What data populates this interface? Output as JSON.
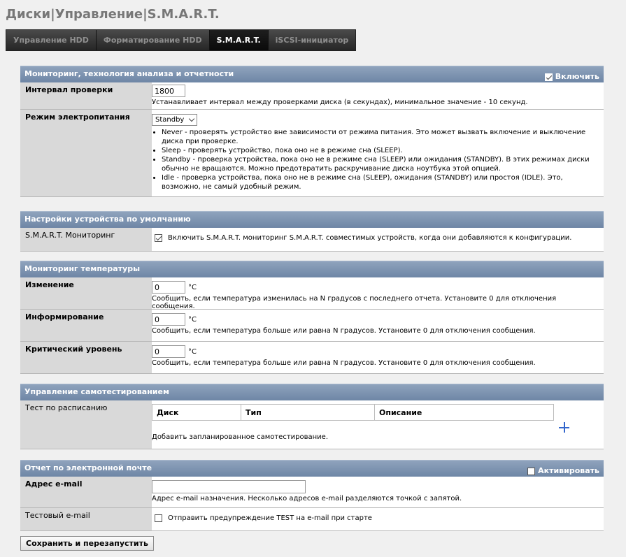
{
  "page_title": "Диски|Управление|S.M.A.R.T.",
  "tabs": [
    {
      "label": "Управление HDD"
    },
    {
      "label": "Форматирование HDD"
    },
    {
      "label": "S.M.A.R.T."
    },
    {
      "label": "iSCSI-инициатор"
    }
  ],
  "active_tab": "S.M.A.R.T.",
  "monitoring": {
    "header": "Мониторинг, технология анализа и отчетности",
    "enable_label": "Включить",
    "enabled": true,
    "interval": {
      "label": "Интервал проверки",
      "value": "1800",
      "desc": "Устанавливает интервал между проверками диска (в секундах), минимальное значение - 10 секунд."
    },
    "power": {
      "label": "Режим электропитания",
      "selected": "Standby",
      "modes": [
        "Never - проверять устройство вне зависимости от режима питания. Это может вызвать включение и выключение диска при проверке.",
        "Sleep - проверять устройство, пока оно не в режиме сна (SLEEP).",
        "Standby - проверка устройства, пока оно не в режиме сна (SLEEP) или ожидания (STANDBY). В этих режимах диски обычно не вращаются. Можно предотвратить раскручивание диска ноутбука этой опцией.",
        "Idle - проверка устройства, пока оно не в режиме сна (SLEEP), ожидания (STANDBY) или простоя (IDLE). Это, возможно, не самый удобный режим."
      ]
    }
  },
  "defaults": {
    "header": "Настройки устройства по умолчанию",
    "smart_label": "S.M.A.R.T. Мониторинг",
    "smart_checked": true,
    "smart_text": "Включить S.M.A.R.T. мониторинг S.M.A.R.T. совместимых устройств, когда они добавляются к конфигурации."
  },
  "temperature": {
    "header": "Мониторинг температуры",
    "rows": [
      {
        "label": "Изменение",
        "value": "0",
        "unit": "°C",
        "desc": "Сообщить, если температура изменилась на N градусов с последнего отчета. Установите 0 для отключения сообщения."
      },
      {
        "label": "Информирование",
        "value": "0",
        "unit": "°C",
        "desc": "Сообщить, если температура больше или равна N градусов. Установите 0 для отключения сообщения."
      },
      {
        "label": "Критический уровень",
        "value": "0",
        "unit": "°C",
        "desc": "Сообщить, если температура больше или равна N градусов. Установите 0 для отключения сообщения."
      }
    ]
  },
  "selftest": {
    "header": "Управление самотестированием",
    "label": "Тест по расписанию",
    "columns": [
      "Диск",
      "Тип",
      "Описание"
    ],
    "add_text": "Добавить запланированное самотестирование."
  },
  "email": {
    "header": "Отчет по электронной почте",
    "activate_label": "Активировать",
    "activated": false,
    "address": {
      "label": "Адрес e-mail",
      "value": "",
      "desc": "Адрес e-mail назначения. Несколько адресов e-mail разделяются точкой с запятой."
    },
    "test": {
      "label": "Тестовый e-mail",
      "checked": false,
      "text": "Отправить предупреждение TEST на e-mail при старте"
    }
  },
  "save_button": "Сохранить и перезапустить"
}
